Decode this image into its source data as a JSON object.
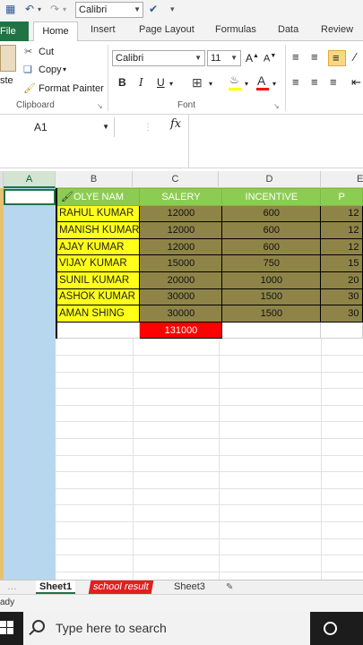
{
  "qat": {
    "font_name": "Calibri"
  },
  "tabs": {
    "file": "File",
    "home": "Home",
    "insert": "Insert",
    "page_layout": "Page Layout",
    "formulas": "Formulas",
    "data": "Data",
    "review": "Review"
  },
  "ribbon": {
    "paste_label": "ste",
    "cut": "Cut",
    "copy": "Copy",
    "format_painter": "Format Painter",
    "clipboard_group": "Clipboard",
    "font_name": "Calibri",
    "font_size": "11",
    "bold": "B",
    "italic": "I",
    "underline": "U",
    "font_group": "Font"
  },
  "formula_bar": {
    "name_box": "A1",
    "fx": "fx",
    "value": ""
  },
  "columns": [
    "A",
    "B",
    "C",
    "D",
    "E"
  ],
  "table": {
    "headers": [
      "OLYE NAM",
      "SALERY",
      "INCENTIVE",
      "P"
    ],
    "rows": [
      {
        "name": "RAHUL KUMAR",
        "salary": "12000",
        "incentive": "600",
        "e": "12"
      },
      {
        "name": "MANISH KUMAR",
        "salary": "12000",
        "incentive": "600",
        "e": "12"
      },
      {
        "name": "AJAY KUMAR",
        "salary": "12000",
        "incentive": "600",
        "e": "12"
      },
      {
        "name": "VIJAY KUMAR",
        "salary": "15000",
        "incentive": "750",
        "e": "15"
      },
      {
        "name": "SUNIL KUMAR",
        "salary": "20000",
        "incentive": "1000",
        "e": "20"
      },
      {
        "name": "ASHOK KUMAR",
        "salary": "30000",
        "incentive": "1500",
        "e": "30"
      },
      {
        "name": "AMAN SHING",
        "salary": "30000",
        "incentive": "1500",
        "e": "30"
      }
    ],
    "total": "131000"
  },
  "sheets": {
    "sheet1": "Sheet1",
    "sheet2": "school result",
    "sheet3": "Sheet3"
  },
  "status": {
    "text": "ady"
  },
  "taskbar": {
    "search_placeholder": "Type here to search"
  },
  "colors": {
    "excel_green": "#217346",
    "header_green": "#8dcc52",
    "name_yellow": "#ffff1a",
    "value_olive": "#8f8448",
    "total_red": "#ff0000",
    "selection_blue": "#b7d7ee"
  }
}
